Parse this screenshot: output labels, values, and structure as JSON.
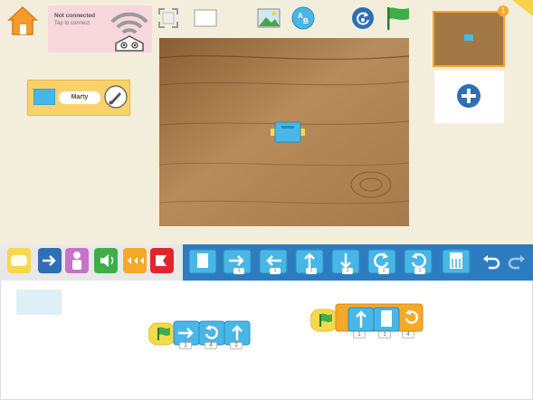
{
  "connection": {
    "status": "Not connected",
    "hint": "Tap to connect"
  },
  "sprite": {
    "name": "Marty"
  },
  "scenes": {
    "current_badge": "1"
  },
  "palette": {
    "block_params": [
      "1",
      "1",
      "1",
      "1",
      "1",
      "1"
    ]
  },
  "scripts": [
    {
      "name": "script-1",
      "params": [
        "1",
        "4",
        "2"
      ]
    },
    {
      "name": "script-2",
      "params": [
        "1",
        "1",
        "4"
      ]
    }
  ],
  "colors": {
    "top_bg": "#f3eedb",
    "blue_bar": "#2e7cc0",
    "block_blue": "#48b6e6",
    "trigger_yellow": "#f7d84b",
    "control_orange": "#f6a827",
    "connect_pink": "#f7d6dc",
    "home_orange": "#f39c2c"
  }
}
